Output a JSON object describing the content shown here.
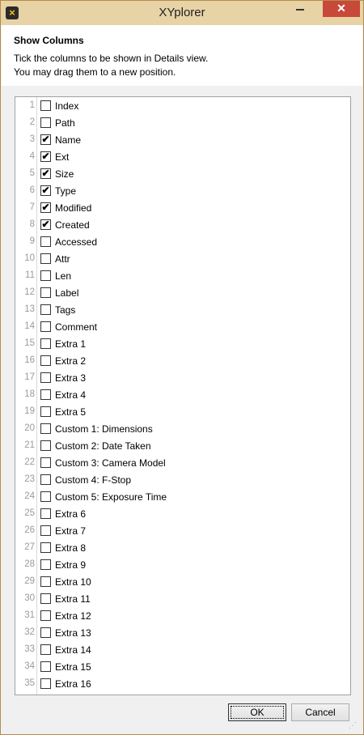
{
  "window": {
    "title": "XYplorer",
    "close_glyph": "✕"
  },
  "header": {
    "title": "Show Columns",
    "line1": "Tick the columns to be shown in Details view.",
    "line2": "You may drag them to a new position."
  },
  "columns": [
    {
      "num": "1",
      "label": "Index",
      "checked": false
    },
    {
      "num": "2",
      "label": "Path",
      "checked": false
    },
    {
      "num": "3",
      "label": "Name",
      "checked": true
    },
    {
      "num": "4",
      "label": "Ext",
      "checked": true
    },
    {
      "num": "5",
      "label": "Size",
      "checked": true
    },
    {
      "num": "6",
      "label": "Type",
      "checked": true
    },
    {
      "num": "7",
      "label": "Modified",
      "checked": true
    },
    {
      "num": "8",
      "label": "Created",
      "checked": true
    },
    {
      "num": "9",
      "label": "Accessed",
      "checked": false
    },
    {
      "num": "10",
      "label": "Attr",
      "checked": false
    },
    {
      "num": "11",
      "label": "Len",
      "checked": false
    },
    {
      "num": "12",
      "label": "Label",
      "checked": false
    },
    {
      "num": "13",
      "label": "Tags",
      "checked": false
    },
    {
      "num": "14",
      "label": "Comment",
      "checked": false
    },
    {
      "num": "15",
      "label": "Extra 1",
      "checked": false
    },
    {
      "num": "16",
      "label": "Extra 2",
      "checked": false
    },
    {
      "num": "17",
      "label": "Extra 3",
      "checked": false
    },
    {
      "num": "18",
      "label": "Extra 4",
      "checked": false
    },
    {
      "num": "19",
      "label": "Extra 5",
      "checked": false
    },
    {
      "num": "20",
      "label": "Custom 1: Dimensions",
      "checked": false
    },
    {
      "num": "21",
      "label": "Custom 2: Date Taken",
      "checked": false
    },
    {
      "num": "22",
      "label": "Custom 3: Camera Model",
      "checked": false
    },
    {
      "num": "23",
      "label": "Custom 4: F-Stop",
      "checked": false
    },
    {
      "num": "24",
      "label": "Custom 5: Exposure Time",
      "checked": false
    },
    {
      "num": "25",
      "label": "Extra 6",
      "checked": false
    },
    {
      "num": "26",
      "label": "Extra 7",
      "checked": false
    },
    {
      "num": "27",
      "label": "Extra 8",
      "checked": false
    },
    {
      "num": "28",
      "label": "Extra 9",
      "checked": false
    },
    {
      "num": "29",
      "label": "Extra 10",
      "checked": false
    },
    {
      "num": "30",
      "label": "Extra 11",
      "checked": false
    },
    {
      "num": "31",
      "label": "Extra 12",
      "checked": false
    },
    {
      "num": "32",
      "label": "Extra 13",
      "checked": false
    },
    {
      "num": "33",
      "label": "Extra 14",
      "checked": false
    },
    {
      "num": "34",
      "label": "Extra 15",
      "checked": false
    },
    {
      "num": "35",
      "label": "Extra 16",
      "checked": false
    }
  ],
  "buttons": {
    "ok": "OK",
    "cancel": "Cancel"
  }
}
